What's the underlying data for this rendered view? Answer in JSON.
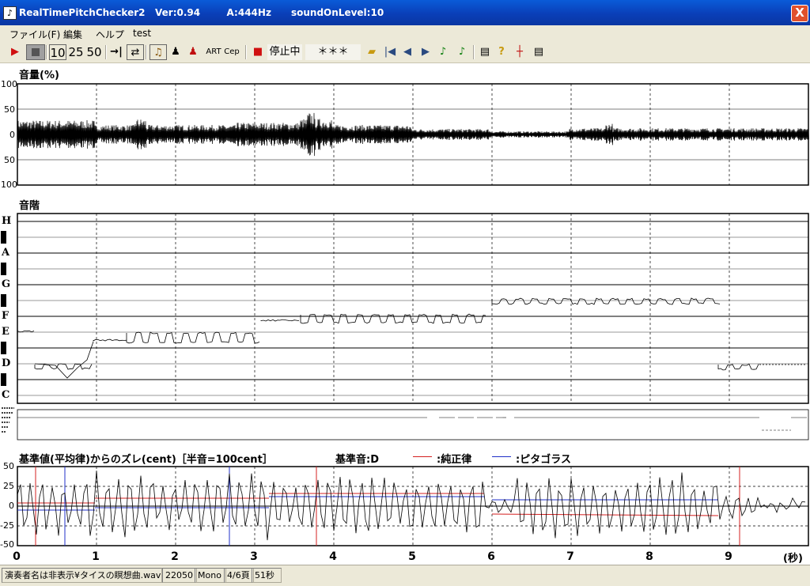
{
  "window": {
    "title": "RealTimePitchChecker2   Ver:0.94        A:444Hz      soundOnLevel:10",
    "close_label": "X"
  },
  "menu": [
    "ファイル(F)",
    "編集",
    "ヘルプ",
    "test"
  ],
  "toolbar": {
    "interval_buttons": [
      "10",
      "25",
      "50"
    ],
    "art_label": "ART",
    "cep_label": "Cep",
    "status_label": "停止中",
    "note_display": "＊＊＊"
  },
  "volume_panel": {
    "title": "音量(%)",
    "y_labels": [
      "100",
      "50",
      "0",
      "50",
      "100"
    ]
  },
  "scale_panel": {
    "title": "音階",
    "notes": [
      "H",
      "A",
      "G",
      "F",
      "E",
      "D",
      "C"
    ]
  },
  "deviation_panel": {
    "title": "基準値(平均律)からのズレ(cent)［半音=100cent］",
    "base_note": "基準音:D",
    "legend_just": ":純正律",
    "legend_pythagorean": ":ピタゴラス",
    "y_labels": [
      "50",
      "25",
      "0",
      "-25",
      "-50"
    ],
    "x_labels": [
      "0",
      "1",
      "2",
      "3",
      "4",
      "5",
      "6",
      "7",
      "8",
      "9"
    ],
    "x_unit": "(秒)"
  },
  "colors": {
    "just": "#d42020",
    "pythagorean": "#2030c8",
    "trace": "#000000"
  },
  "status": {
    "file": "演奏者名は非表示¥タイスの瞑想曲.wav",
    "rate": "22050",
    "channels": "Mono",
    "page": "4/6頁",
    "duration": "51秒"
  }
}
